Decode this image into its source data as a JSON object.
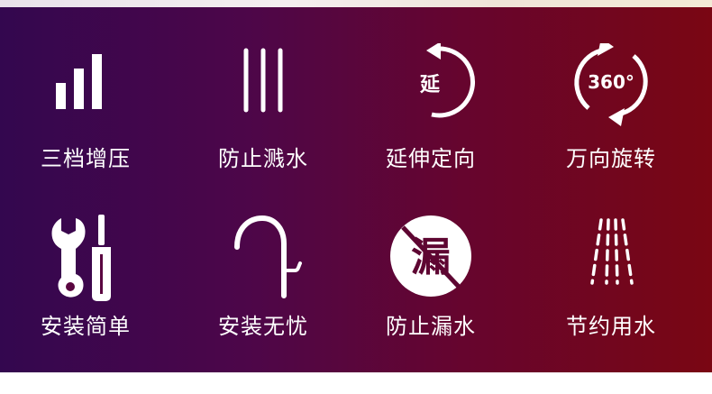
{
  "features": [
    {
      "label": "三档增压",
      "icon": "signal-bars-icon"
    },
    {
      "label": "防止溅水",
      "icon": "water-streams-icon"
    },
    {
      "label": "延伸定向",
      "icon": "extend-rotate-icon",
      "glyph": "延"
    },
    {
      "label": "万向旋转",
      "icon": "rotate-360-icon",
      "glyph": "360°"
    },
    {
      "label": "安装简单",
      "icon": "tools-icon"
    },
    {
      "label": "安装无忧",
      "icon": "faucet-icon"
    },
    {
      "label": "防止漏水",
      "icon": "no-leak-icon",
      "glyph": "漏"
    },
    {
      "label": "节约用水",
      "icon": "spray-lines-icon"
    }
  ],
  "colors": {
    "gradient_start": "#33074f",
    "gradient_end": "#7a0613",
    "foreground": "#ffffff"
  }
}
